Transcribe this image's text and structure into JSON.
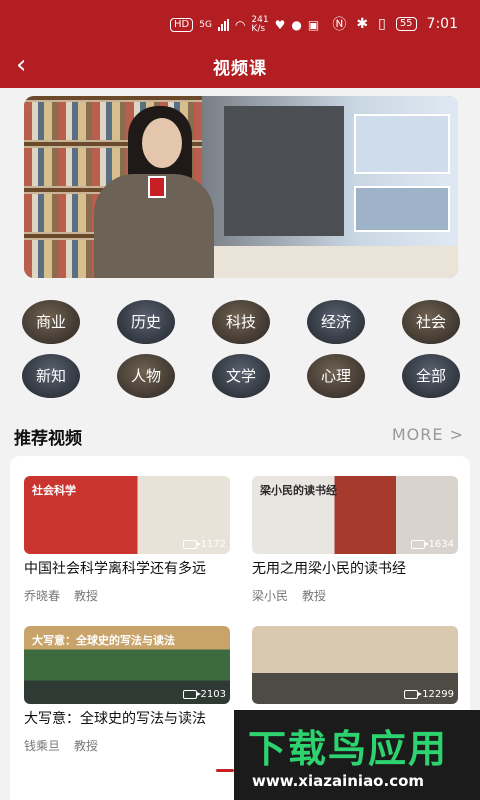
{
  "status_bar": {
    "network_speed_value": "241",
    "network_speed_unit": "K/s",
    "battery": "55",
    "time": "7:01",
    "hd_label": "HD",
    "net_label": "5G"
  },
  "nav": {
    "title": "视频课"
  },
  "categories": [
    {
      "label": "商业"
    },
    {
      "label": "历史"
    },
    {
      "label": "科技"
    },
    {
      "label": "经济"
    },
    {
      "label": "社会"
    },
    {
      "label": "新知"
    },
    {
      "label": "人物"
    },
    {
      "label": "文学"
    },
    {
      "label": "心理"
    },
    {
      "label": "全部"
    }
  ],
  "section": {
    "title": "推荐视频",
    "more_label": "MORE >"
  },
  "videos": [
    {
      "title": "中国社会科学离科学还有多远",
      "author": "乔晓春",
      "role": "教授",
      "duration": "1172",
      "thumb_text": "社会科学"
    },
    {
      "title": "无用之用梁小民的读书经",
      "author": "梁小民",
      "role": "教授",
      "duration": "1634",
      "thumb_text": "梁小民的读书经"
    },
    {
      "title": "大写意：全球史的写法与读法",
      "author": "钱乘旦",
      "role": "教授",
      "duration": "2103",
      "thumb_text": "大写意：全球史的写法与读法"
    },
    {
      "title": "",
      "author": "",
      "role": "",
      "duration": "12299",
      "thumb_text": ""
    }
  ],
  "watermark": {
    "main": "下载鸟应用",
    "sub": "www.xiazainiao.com"
  },
  "colors": {
    "brand_red": "#b21e22",
    "watermark_green": "#2dd36f"
  }
}
